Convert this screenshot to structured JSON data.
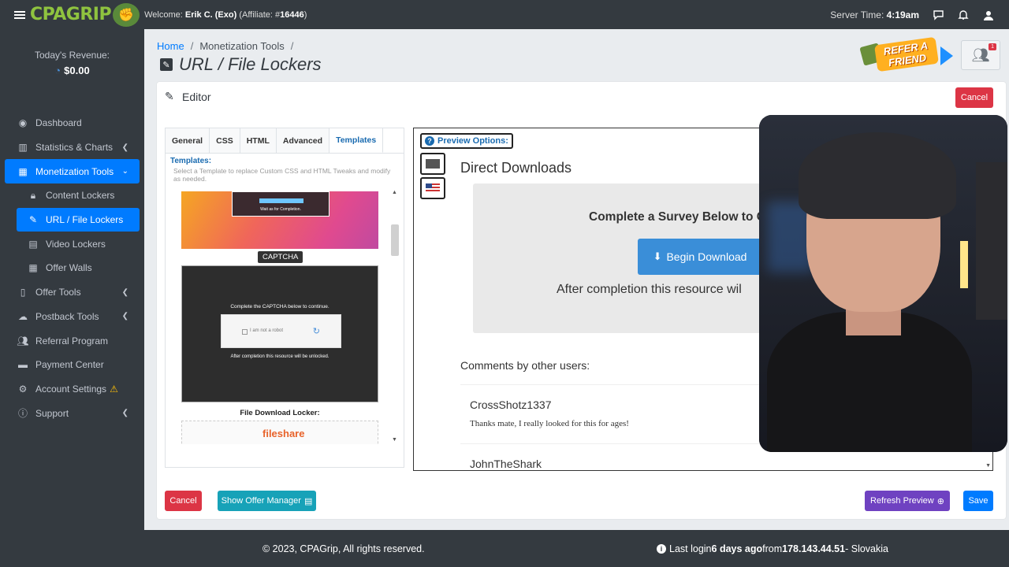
{
  "topbar": {
    "logo": "CPAGRIP",
    "welcome_prefix": "Welcome: ",
    "user": "Erik C. (Exo)",
    "affiliate": "(Affiliate: #",
    "affiliate_id": "16446",
    "affiliate_close": ")",
    "server_time_label": "Server Time: ",
    "server_time": "4:19am"
  },
  "sidebar": {
    "revenue_label": "Today's Revenue:",
    "revenue_value": "$0.00",
    "items": [
      {
        "label": "Dashboard"
      },
      {
        "label": "Statistics & Charts"
      },
      {
        "label": "Monetization Tools"
      },
      {
        "label": "Content Lockers"
      },
      {
        "label": "URL / File Lockers"
      },
      {
        "label": "Video Lockers"
      },
      {
        "label": "Offer Walls"
      },
      {
        "label": "Offer Tools"
      },
      {
        "label": "Postback Tools"
      },
      {
        "label": "Referral Program"
      },
      {
        "label": "Payment Center"
      },
      {
        "label": "Account Settings"
      },
      {
        "label": "Support"
      }
    ]
  },
  "breadcrumb": {
    "home": "Home",
    "section": "Monetization Tools",
    "sep": "/"
  },
  "page_title": "URL / File Lockers",
  "refer": {
    "text": "REFER A FRIEND",
    "badge_count": "1"
  },
  "card": {
    "title": "Editor",
    "cancel_top": "Cancel",
    "tabs": [
      "General",
      "CSS",
      "HTML",
      "Advanced",
      "Templates"
    ],
    "templates_label": "Templates:",
    "templates_desc": "Select a Template to replace Custom CSS and HTML Tweaks and modify as needed.",
    "tpl1_caption": "Wait as for Completion.",
    "captcha_tag": "CAPTCHA",
    "captcha_title": "Complete the CAPTCHA below to continue.",
    "captcha_check": "I am not a robot",
    "captcha_foot": "After completion this resource will be unlocked.",
    "file_download_label": "File Download Locker:",
    "fileshare": "fileshare"
  },
  "preview": {
    "options_label": "Preview Options:",
    "title": "Direct Downloads",
    "survey_heading": "Complete a Survey Below to C",
    "begin_button": "Begin Download",
    "after_text": "After completion this resource wil",
    "comments_heading": "Comments by other users:",
    "comments": [
      {
        "user": "CrossShotz1337",
        "text": "Thanks mate, I really looked for this for ages!"
      },
      {
        "user": "JohnTheShark",
        "text": ""
      }
    ]
  },
  "bottom_buttons": {
    "cancel": "Cancel",
    "offer_manager": "Show Offer Manager",
    "refresh": "Refresh Preview",
    "save": "Save"
  },
  "footer": {
    "copyright": "© 2023, CPAGrip, All rights reserved.",
    "last_login_prefix": "Last login ",
    "last_login_when": "6 days ago",
    "last_login_from": " from ",
    "ip": "178.143.44.51",
    "country": " - Slovakia"
  },
  "colors": {
    "primary": "#007bff",
    "danger": "#dc3545",
    "teal": "#17a2b8",
    "purple": "#6f42c1",
    "dark": "#343a40"
  }
}
